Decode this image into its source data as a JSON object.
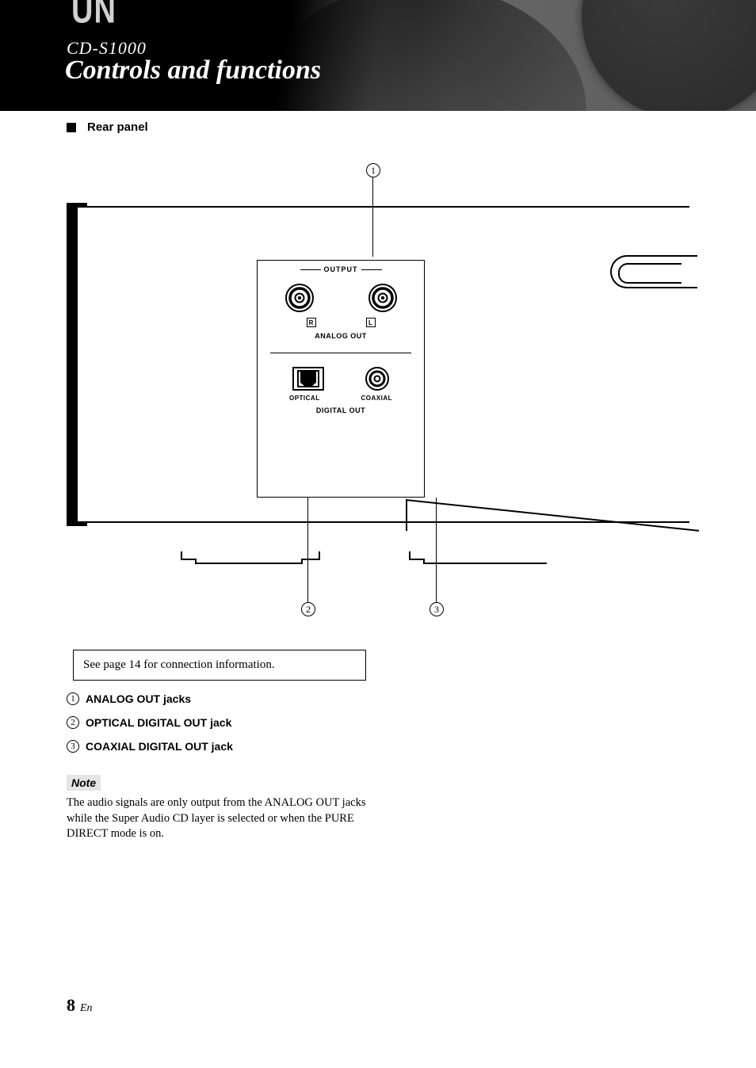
{
  "header": {
    "logo_fragment": "UN",
    "model": "CD-S1000",
    "title": "Controls and functions"
  },
  "subheading": "Rear panel",
  "diagram": {
    "output_label": "OUTPUT",
    "channel_r": "R",
    "channel_l": "L",
    "analog_out": "ANALOG OUT",
    "optical": "OPTICAL",
    "coaxial": "COAXIAL",
    "digital_out": "DIGITAL OUT",
    "callouts": {
      "c1": "1",
      "c2": "2",
      "c3": "3"
    }
  },
  "info_box": "See page 14 for connection information.",
  "items": [
    {
      "num": "1",
      "label": "ANALOG OUT jacks"
    },
    {
      "num": "2",
      "label": "OPTICAL DIGITAL OUT jack"
    },
    {
      "num": "3",
      "label": "COAXIAL DIGITAL OUT jack"
    }
  ],
  "note": {
    "heading": "Note",
    "body": "The audio signals are only output from the ANALOG OUT jacks while the Super Audio CD layer is selected or when the PURE DIRECT mode is on."
  },
  "footer": {
    "page": "8",
    "lang": "En"
  }
}
